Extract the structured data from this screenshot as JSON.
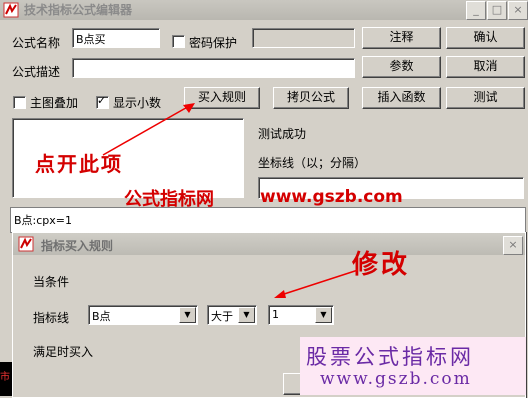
{
  "window": {
    "title": "技术指标公式编辑器",
    "min": "_",
    "max": "□",
    "close": "×"
  },
  "form": {
    "name_label": "公式名称",
    "name_value": "B点买",
    "password_label": "密码保护",
    "desc_label": "公式描述",
    "desc_value": "",
    "main_overlay_label": "主图叠加",
    "show_decimal_label": "显示小数",
    "show_decimal_checked": true
  },
  "buttons": {
    "annotate": "注释",
    "confirm": "确认",
    "params": "参数",
    "cancel": "取消",
    "buy_rule": "买入规则",
    "copy_formula": "拷贝公式",
    "insert_func": "插入函数",
    "test": "测试"
  },
  "status": {
    "test_result": "测试成功",
    "coord_line": "坐标线（以；分隔）"
  },
  "annotations": {
    "click_here": "点开此项",
    "site_cn": "公式指标网",
    "site_url": "www.gszb.com",
    "modify": "修改"
  },
  "code": {
    "line1": "B点:cpx=1"
  },
  "dialog": {
    "title": "指标买入规则",
    "close": "×",
    "condition_label": "当条件",
    "indicator_label": "指标线",
    "indicator_value": "B点",
    "operator_value": "大于",
    "threshold_value": "1",
    "buy_when_met": "满足时买入"
  },
  "watermark": {
    "title": "股票公式指标网",
    "url": "www.gszb.com"
  },
  "colors": {
    "annotation_red": "#d40000",
    "watermark_bg": "#fde8f4",
    "watermark_text": "#6a2aa5"
  }
}
